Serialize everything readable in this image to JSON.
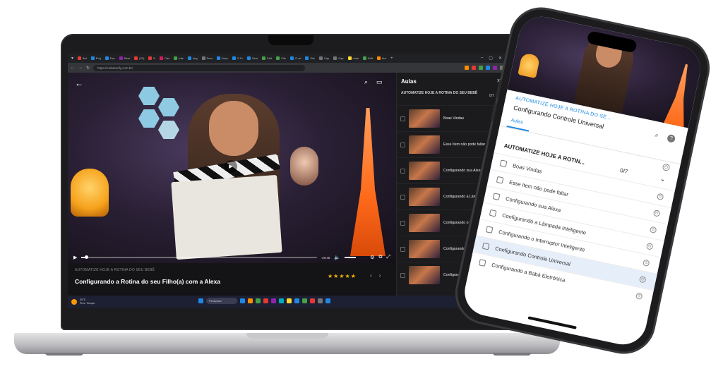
{
  "browser": {
    "url": "https://clubtoreify.com.br/",
    "tabs": [
      {
        "label": "Bel",
        "color": "#e53935"
      },
      {
        "label": "Proj",
        "color": "#1e88e5"
      },
      {
        "label": "Doc",
        "color": "#1e88e5"
      },
      {
        "label": "Bem",
        "color": "#8e24aa"
      },
      {
        "label": "(29)",
        "color": "#e53935"
      },
      {
        "label": "E",
        "color": "#e53935"
      },
      {
        "label": "Cas",
        "color": "#d81b60"
      },
      {
        "label": "Infe",
        "color": "#43a047"
      },
      {
        "label": "Img",
        "color": "#1e88e5"
      },
      {
        "label": "Sem",
        "color": "#757575"
      },
      {
        "label": "Desc",
        "color": "#1e88e5"
      },
      {
        "label": "G Fr",
        "color": "#1e88e5"
      },
      {
        "label": "Sem",
        "color": "#1e88e5"
      },
      {
        "label": "Edit",
        "color": "#43a047"
      },
      {
        "label": "Clie",
        "color": "#43a047"
      },
      {
        "label": "G cri",
        "color": "#1e88e5"
      },
      {
        "label": "Ofe",
        "color": "#1e88e5"
      },
      {
        "label": "Cap",
        "color": "#757575"
      },
      {
        "label": "Cap",
        "color": "#757575"
      },
      {
        "label": "crias",
        "color": "#fdd835"
      },
      {
        "label": "Edit",
        "color": "#43a047"
      },
      {
        "label": "Áre",
        "color": "#fb8c00"
      }
    ],
    "extension_colors": [
      "#fb8c00",
      "#e53935",
      "#43a047",
      "#1e88e5",
      "#8e24aa",
      "#757575"
    ]
  },
  "player": {
    "time": "-28:45",
    "progress": 0.02
  },
  "lesson_info": {
    "course": "AUTOMATIZE HOJE A ROTINA DO SEU BEBÊ",
    "title": "Configurando a Rotina do seu Filho(a) com a Alexa",
    "stars": "★★★★★",
    "prev": "‹",
    "next": "›"
  },
  "panel": {
    "title": "Aulas",
    "close": "✕",
    "module": "AUTOMATIZE HOJE A ROTINA DO SEU BEBÊ",
    "count": "0/7",
    "lessons": [
      {
        "label": "Boas Vindas"
      },
      {
        "label": "Esse Item não pode faltar"
      },
      {
        "label": "Configurando sua Alexa"
      },
      {
        "label": "Configurando a Lâmpada Inteligente"
      },
      {
        "label": "Configurando o Interruptor Inteligente"
      },
      {
        "label": "Configurando o Controle Universal"
      },
      {
        "label": "Configurando a Babá Eletrônica"
      }
    ]
  },
  "taskbar": {
    "temp": "20°C",
    "weather": "Prev. Tempo",
    "search": "Pesquisar",
    "icon_colors": [
      "#1e88e5",
      "#fb8c00",
      "#43a047",
      "#e53935",
      "#8e24aa",
      "#00acc1",
      "#fdd835",
      "#1e88e5",
      "#43a047",
      "#e53935",
      "#757575",
      "#1e88e5"
    ]
  },
  "phone": {
    "course": "AUTOMATIZE HOJE A ROTINA DO SE...",
    "title": "Configurando Controle Universal",
    "tab": "Aulas",
    "module": "AUTOMATIZE HOJE A ROTIN...",
    "count": "0/7",
    "help": "?",
    "lessons": [
      {
        "label": "Boas Vindas",
        "active": false
      },
      {
        "label": "Esse Item não pode faltar",
        "active": false
      },
      {
        "label": "Configurando sua Alexa",
        "active": false
      },
      {
        "label": "Configurando a Lâmpada Inteligente",
        "active": false
      },
      {
        "label": "Configurando o Interruptor Inteligente",
        "active": false
      },
      {
        "label": "Configurando Controle Universal",
        "active": true
      },
      {
        "label": "Configurando a Babá Eletrônica",
        "active": false
      }
    ]
  }
}
